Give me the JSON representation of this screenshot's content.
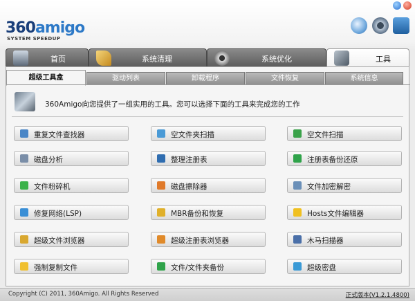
{
  "app": {
    "logo_main_a": "360",
    "logo_main_b": "amigo",
    "logo_sub": "SYSTEM SPEEDUP",
    "header_icons": [
      "refresh-icon",
      "settings-icon",
      "user-icon"
    ],
    "window_controls": [
      "minimize-icon",
      "close-icon"
    ]
  },
  "main_tabs": [
    {
      "label": "首页",
      "icon": "home-icon",
      "active": false
    },
    {
      "label": "系统清理",
      "icon": "broom-icon",
      "active": false
    },
    {
      "label": "系统优化",
      "icon": "gear-icon",
      "active": false
    },
    {
      "label": "工具",
      "icon": "tools-icon",
      "active": true
    }
  ],
  "sub_tabs": [
    {
      "label": "超级工具盒",
      "active": true
    },
    {
      "label": "驱动列表",
      "active": false
    },
    {
      "label": "卸载程序",
      "active": false
    },
    {
      "label": "文件恢复",
      "active": false
    },
    {
      "label": "系统信息",
      "active": false
    }
  ],
  "intro": {
    "text": "360Amigo向您提供了一组实用的工具。您可以选择下面的工具来完成您的工作",
    "icon": "toolbox-icon"
  },
  "tools": [
    {
      "label": "重复文件查找器",
      "icon": "people-icon",
      "color": "#4a86c6"
    },
    {
      "label": "空文件夹扫描",
      "icon": "folder-icon",
      "color": "#4a9ad6"
    },
    {
      "label": "空文件扫描",
      "icon": "file-scan-icon",
      "color": "#3aa24a"
    },
    {
      "label": "磁盘分析",
      "icon": "disk-icon",
      "color": "#7a8ea8"
    },
    {
      "label": "整理注册表",
      "icon": "registry-icon",
      "color": "#2f6db0"
    },
    {
      "label": "注册表备份还原",
      "icon": "plus-icon",
      "color": "#2fa34a"
    },
    {
      "label": "文件粉碎机",
      "icon": "shredder-icon",
      "color": "#3bb24a"
    },
    {
      "label": "磁盘擦除器",
      "icon": "eraser-icon",
      "color": "#e07a2a"
    },
    {
      "label": "文件加密解密",
      "icon": "lock-file-icon",
      "color": "#6a8fb8"
    },
    {
      "label": "修复网络(LSP)",
      "icon": "network-icon",
      "color": "#3a8fd6"
    },
    {
      "label": "MBR备份和恢复",
      "icon": "mbr-icon",
      "color": "#e0b02a"
    },
    {
      "label": "Hosts文件编辑器",
      "icon": "star-icon",
      "color": "#f0c020"
    },
    {
      "label": "超级文件浏览器",
      "icon": "tag-icon",
      "color": "#d9a830"
    },
    {
      "label": "超级注册表浏览器",
      "icon": "registry-browser-icon",
      "color": "#e08a2a"
    },
    {
      "label": "木马扫描器",
      "icon": "grid-icon",
      "color": "#4a6fa8"
    },
    {
      "label": "强制复制文件",
      "icon": "folder-copy-icon",
      "color": "#f0c030"
    },
    {
      "label": "文件/文件夹备份",
      "icon": "backup-icon",
      "color": "#2fa34a"
    },
    {
      "label": "超级密盘",
      "icon": "chat-icon",
      "color": "#3a9ad6"
    }
  ],
  "statusbar": {
    "copyright": "Copyright (C) 2011, 360Amigo. All Rights Reserved",
    "version": "正式版本(V1.2.1.4800)"
  }
}
